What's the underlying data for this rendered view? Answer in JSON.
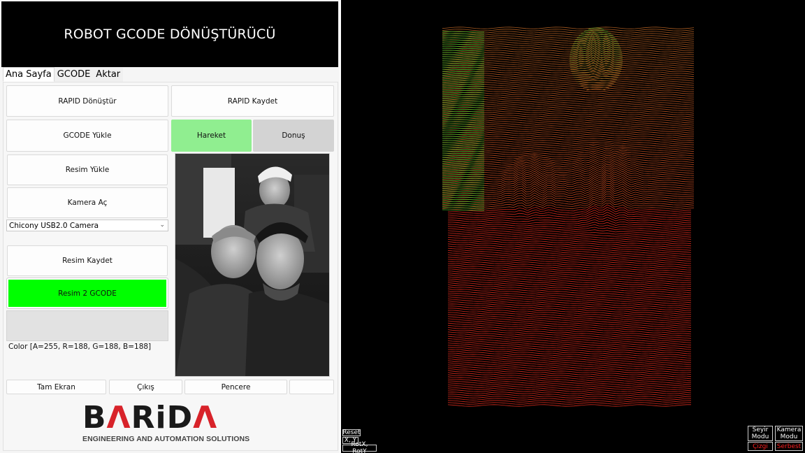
{
  "app": {
    "title": "ROBOT GCODE DÖNÜŞTÜRÜCÜ"
  },
  "tabs": [
    {
      "label": "Ana Sayfa",
      "active": true
    },
    {
      "label": "GCODE",
      "active": false
    },
    {
      "label": "Aktar",
      "active": false
    }
  ],
  "buttons": {
    "rapid_convert": "RAPID Dönüştür",
    "rapid_save": "RAPID Kaydet",
    "gcode_load": "GCODE Yükle",
    "motion": "Hareket",
    "rotation": "Donuş",
    "image_load": "Resim Yükle",
    "camera_open": "Kamera Aç",
    "image_save": "Resim Kaydet",
    "image_to_gcode": "Resim 2 GCODE",
    "fullscreen": "Tam Ekran",
    "exit": "Çıkış",
    "window": "Pencere",
    "blank": ""
  },
  "camera": {
    "selected": "Chicony USB2.0 Camera"
  },
  "color": {
    "label": "Color [A=255, R=188, G=188, B=188]",
    "swatch": "#e2e2e2"
  },
  "logo": {
    "word_a": "B",
    "word_b": "Λ",
    "word_c": "RiD",
    "word_d": "Λ",
    "subtitle": "ENGINEERING AND AUTOMATION SOLUTIONS"
  },
  "viewport": {
    "reset": "Reset",
    "xy": "X, Y",
    "rot": "RotX, RotY",
    "seyir": "Seyir Modu",
    "kamera": "Kamera Modu",
    "cizgi": "Çizgi",
    "serbest": "Serbest"
  },
  "colors": {
    "motion_active": "#90ee90",
    "rotation_inactive": "#d3d3d3",
    "convert_accent": "#00ff00",
    "path_red": "#d42a1c",
    "path_green": "#3fbf2a",
    "logo_red": "#d8232a"
  },
  "icons": {
    "dropdown": "chevron-down-icon"
  }
}
